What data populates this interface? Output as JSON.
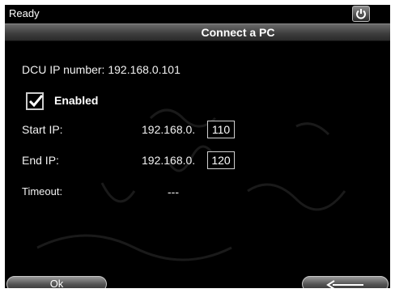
{
  "status": {
    "text": "Ready",
    "power_icon": "power-icon"
  },
  "header": {
    "title": "Connect a PC"
  },
  "dcu": {
    "text": "DCU IP number: 192.168.0.101"
  },
  "enabled": {
    "checked": true,
    "label": "Enabled"
  },
  "start_ip": {
    "label": "Start IP:",
    "prefix": "192.168.0.",
    "value": "110"
  },
  "end_ip": {
    "label": "End IP:",
    "prefix": "192.168.0.",
    "value": "120"
  },
  "timeout": {
    "label": "Timeout:",
    "value": "---"
  },
  "softkeys": {
    "ok_label": "Ok",
    "back_icon": "back-arrow-icon"
  },
  "colors": {
    "background": "#000000",
    "text": "#ffffff",
    "border": "#d0d0d0"
  }
}
